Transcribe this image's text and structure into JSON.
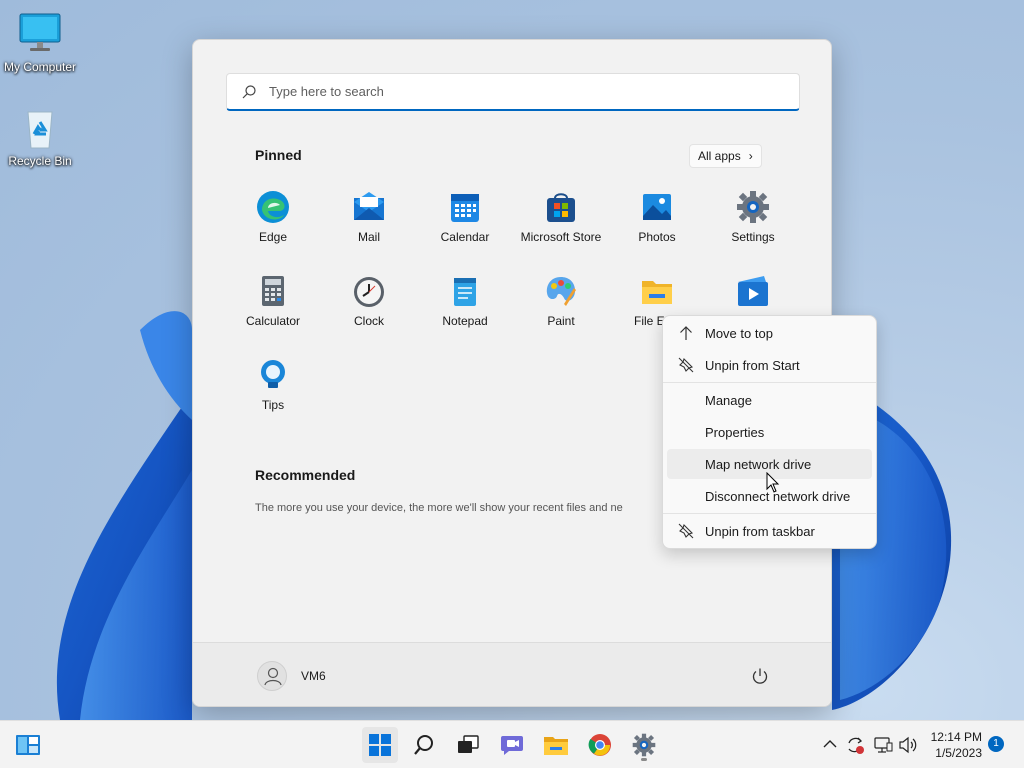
{
  "desktop": {
    "icons": [
      {
        "label": "My Computer",
        "icon": "monitor-icon"
      },
      {
        "label": "Recycle Bin",
        "icon": "recycle-bin-icon"
      }
    ]
  },
  "start_menu": {
    "search_placeholder": "Type here to search",
    "pinned_title": "Pinned",
    "all_apps_label": "All apps",
    "all_apps_chevron": "›",
    "pinned_apps": [
      {
        "label": "Edge",
        "icon": "edge-icon"
      },
      {
        "label": "Mail",
        "icon": "mail-icon"
      },
      {
        "label": "Calendar",
        "icon": "calendar-icon"
      },
      {
        "label": "Microsoft Store",
        "icon": "store-icon"
      },
      {
        "label": "Photos",
        "icon": "photos-icon"
      },
      {
        "label": "Settings",
        "icon": "gear-icon"
      },
      {
        "label": "Calculator",
        "icon": "calculator-icon"
      },
      {
        "label": "Clock",
        "icon": "clock-icon"
      },
      {
        "label": "Notepad",
        "icon": "notepad-icon"
      },
      {
        "label": "Paint",
        "icon": "paint-icon"
      },
      {
        "label": "File Expl",
        "icon": "folder-icon"
      },
      {
        "label": "",
        "icon": "video-editor-icon"
      },
      {
        "label": "Tips",
        "icon": "tips-icon"
      }
    ],
    "recommended_title": "Recommended",
    "recommended_text": "The more you use your device, the more we'll show your recent files and ne",
    "user_name": "VM6"
  },
  "context_menu": {
    "items": [
      {
        "label": "Move to top",
        "icon": "arrow-up-icon"
      },
      {
        "label": "Unpin from Start",
        "icon": "unpin-icon"
      },
      {
        "label": "Manage",
        "icon": ""
      },
      {
        "label": "Properties",
        "icon": ""
      },
      {
        "label": "Map network drive",
        "icon": ""
      },
      {
        "label": "Disconnect network drive",
        "icon": ""
      },
      {
        "label": "Unpin from taskbar",
        "icon": "unpin-icon"
      }
    ]
  },
  "taskbar": {
    "time": "12:14 PM",
    "date": "1/5/2023",
    "notification_count": "1"
  },
  "colors": {
    "accent": "#0067c0",
    "start_bg": "#f2f2f2"
  }
}
